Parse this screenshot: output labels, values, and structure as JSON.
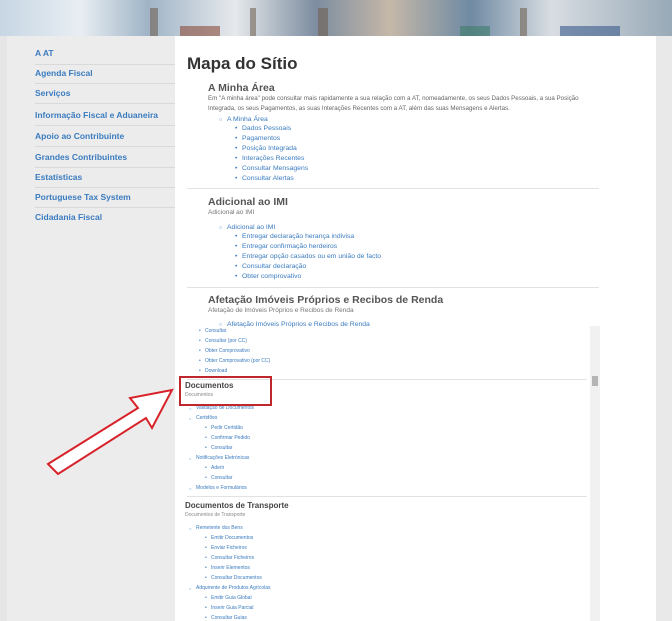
{
  "sidebar": {
    "items": [
      {
        "label": "A AT"
      },
      {
        "label": "Agenda Fiscal"
      },
      {
        "label": "Serviços"
      },
      {
        "label": "Informação Fiscal e Aduaneira"
      },
      {
        "label": "Apoio ao Contribuinte"
      },
      {
        "label": "Grandes Contribuintes"
      },
      {
        "label": "Estatísticas"
      },
      {
        "label": "Portuguese Tax System"
      },
      {
        "label": "Cidadania Fiscal"
      }
    ]
  },
  "main": {
    "title": "Mapa do Sítio",
    "sections": [
      {
        "title": "A Minha Área",
        "description": "Em \"A minha área\" pode consultar mais rapidamente a sua relação com a AT, nomeadamente, os seus Dados Pessoais, a sua Posição Integrada, os seus Pagamentos, as suas Interações Recentes com a AT, além das suas Mensagens e Alertas.",
        "parent": "A Minha Área",
        "links": [
          "Dados Pessoais",
          "Pagamentos",
          "Posição Integrada",
          "Interações Recentes",
          "Consultar Mensagens",
          "Consultar Alertas"
        ]
      },
      {
        "title": "Adicional ao IMI",
        "subtitle": "Adicional ao IMI",
        "parent": "Adicional ao IMI",
        "links": [
          "Entregar declaração herança indivisa",
          "Entregar confirmação herdeiros",
          "Entregar opção casados ou em união de facto",
          "Consultar declaração",
          "Obter comprovativo"
        ]
      },
      {
        "title": "Afetação Imóveis Próprios e Recibos de Renda",
        "subtitle": "Afetação de Imóveis Próprios e Recibos de Renda",
        "parent": "Afetação Imóveis Próprios e Recibos de Renda"
      }
    ],
    "scrolled": {
      "afetacao_links": [
        "Consultar",
        "Consultar (por CC)",
        "Obter Comprovativo",
        "Obter Comprovativo (por CC)",
        "Download"
      ],
      "documentos": {
        "title": "Documentos",
        "subtitle": "Documentos",
        "items": [
          {
            "label": "Validação de Documentos",
            "level": 1
          },
          {
            "label": "Certidões",
            "level": 1
          },
          {
            "label": "Pedir Certidão",
            "level": 2
          },
          {
            "label": "Confirmar Pedido",
            "level": 2
          },
          {
            "label": "Consultar",
            "level": 2
          },
          {
            "label": "Notificações Eletrónicas",
            "level": 1
          },
          {
            "label": "Aderir",
            "level": 2
          },
          {
            "label": "Consultar",
            "level": 2
          },
          {
            "label": "Modelos e Formulários",
            "level": 1
          }
        ]
      },
      "transporte": {
        "title": "Documentos de Transporte",
        "subtitle": "Documentos de Transporte",
        "items": [
          {
            "label": "Remetente dos Bens",
            "level": 1
          },
          {
            "label": "Emitir Documentos",
            "level": 2
          },
          {
            "label": "Enviar Ficheiros",
            "level": 2
          },
          {
            "label": "Consultar Ficheiros",
            "level": 2
          },
          {
            "label": "Inserir Elementos",
            "level": 2
          },
          {
            "label": "Consultar Documentos",
            "level": 2
          },
          {
            "label": "Adquirente de Produtos Agrícolas",
            "level": 1
          },
          {
            "label": "Emitir Guia Global",
            "level": 2
          },
          {
            "label": "Inserir Guia Parcial",
            "level": 2
          },
          {
            "label": "Consultar Guias",
            "level": 2
          }
        ]
      }
    }
  },
  "colors": {
    "link": "#3a7bbf",
    "sidebar_bg": "#ececec",
    "highlight": "#c0272d",
    "arrow": "#d8222a"
  },
  "icons": {
    "annotation": "outline-arrow-icon"
  }
}
